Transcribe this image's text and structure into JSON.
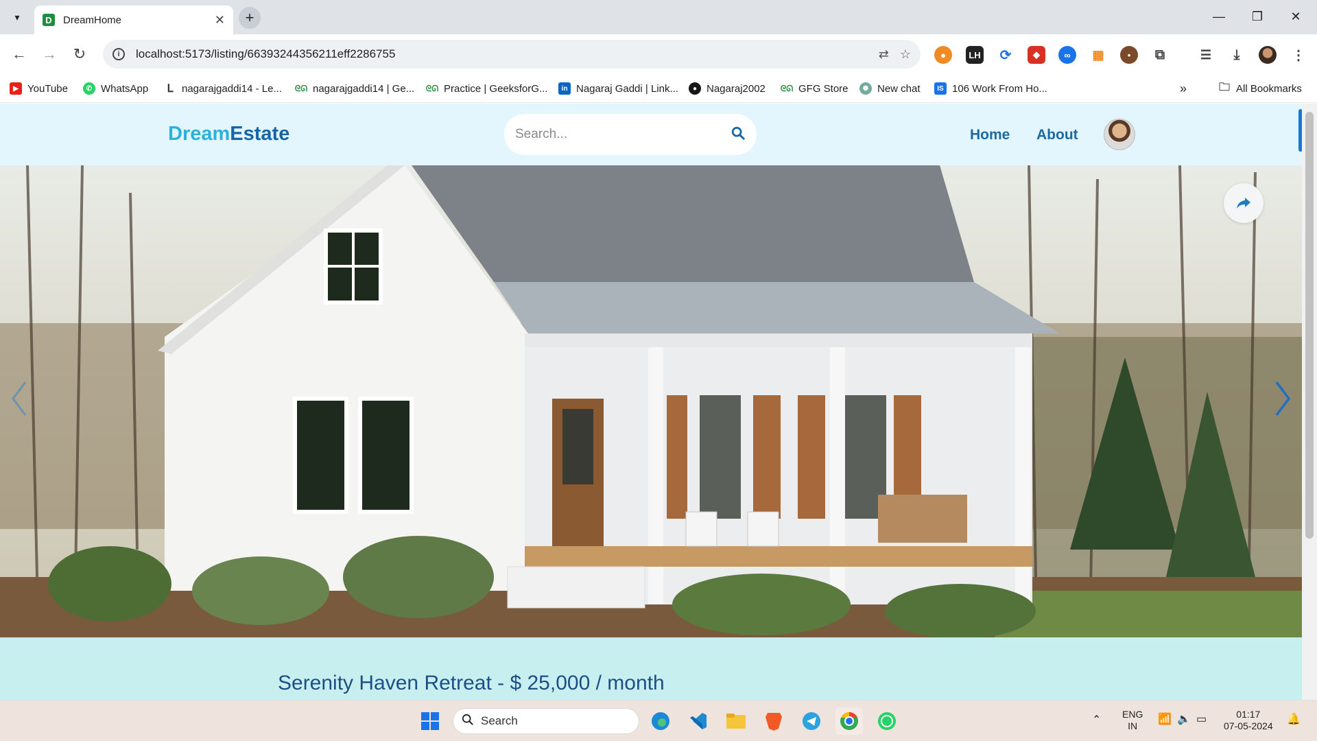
{
  "browser": {
    "tab_title": "DreamHome",
    "tab_favicon": "D",
    "url": "localhost:5173/listing/66393244356211eff2286755",
    "bookmarks": [
      {
        "label": "YouTube",
        "icon": "youtube-icon",
        "color": "#e62117"
      },
      {
        "label": "WhatsApp",
        "icon": "whatsapp-icon",
        "color": "#25d366"
      },
      {
        "label": "nagarajgaddi14 - Le...",
        "icon": "leetcode-icon",
        "color": "#f89f1b"
      },
      {
        "label": "nagarajgaddi14 | Ge...",
        "icon": "gfg-icon",
        "color": "#2f8d46"
      },
      {
        "label": "Practice | GeeksforG...",
        "icon": "gfg-icon",
        "color": "#2f8d46"
      },
      {
        "label": "Nagaraj Gaddi | Link...",
        "icon": "linkedin-icon",
        "color": "#0a66c2"
      },
      {
        "label": "Nagaraj2002",
        "icon": "github-icon",
        "color": "#181717"
      },
      {
        "label": "GFG Store",
        "icon": "gfg-icon",
        "color": "#2f8d46"
      },
      {
        "label": "New chat",
        "icon": "chatgpt-icon",
        "color": "#74aa9c"
      },
      {
        "label": "106 Work From Ho...",
        "icon": "site-icon",
        "color": "#1a73e8"
      }
    ],
    "all_bookmarks": "All Bookmarks"
  },
  "site": {
    "logo_part1": "Dream",
    "logo_part2": "Estate",
    "search_placeholder": "Search...",
    "nav": {
      "home": "Home",
      "about": "About"
    },
    "listing_title": "Serenity Haven Retreat - $ 25,000 / month"
  },
  "taskbar": {
    "search_label": "Search",
    "lang_line1": "ENG",
    "lang_line2": "IN",
    "time": "01:17",
    "date": "07-05-2024"
  },
  "colors": {
    "accent_blue": "#1565a7",
    "logo_light": "#2bb1da",
    "header_bg": "#e3f5fd",
    "content_bg": "#c7eff0"
  }
}
